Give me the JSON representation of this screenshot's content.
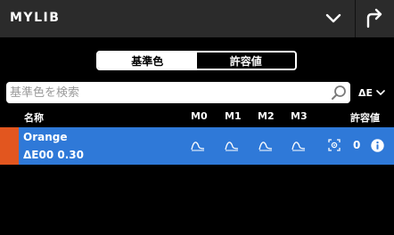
{
  "app": {
    "title": "MYLIB"
  },
  "segment": {
    "active_label": "基準色",
    "inactive_label": "許容値"
  },
  "search": {
    "placeholder": "基準色を検索",
    "value": ""
  },
  "sort": {
    "label": "ΔE"
  },
  "columns": {
    "name": "名称",
    "m0": "M0",
    "m1": "M1",
    "m2": "M2",
    "m3": "M3",
    "tolerance": "許容値"
  },
  "rows": [
    {
      "name": "Orange",
      "delta": "ΔE00  0.30",
      "tolerance": "0",
      "swatch_color": "#e2561f"
    }
  ],
  "colors": {
    "accent": "#2f79d8",
    "topbar": "#2b2b2b"
  }
}
